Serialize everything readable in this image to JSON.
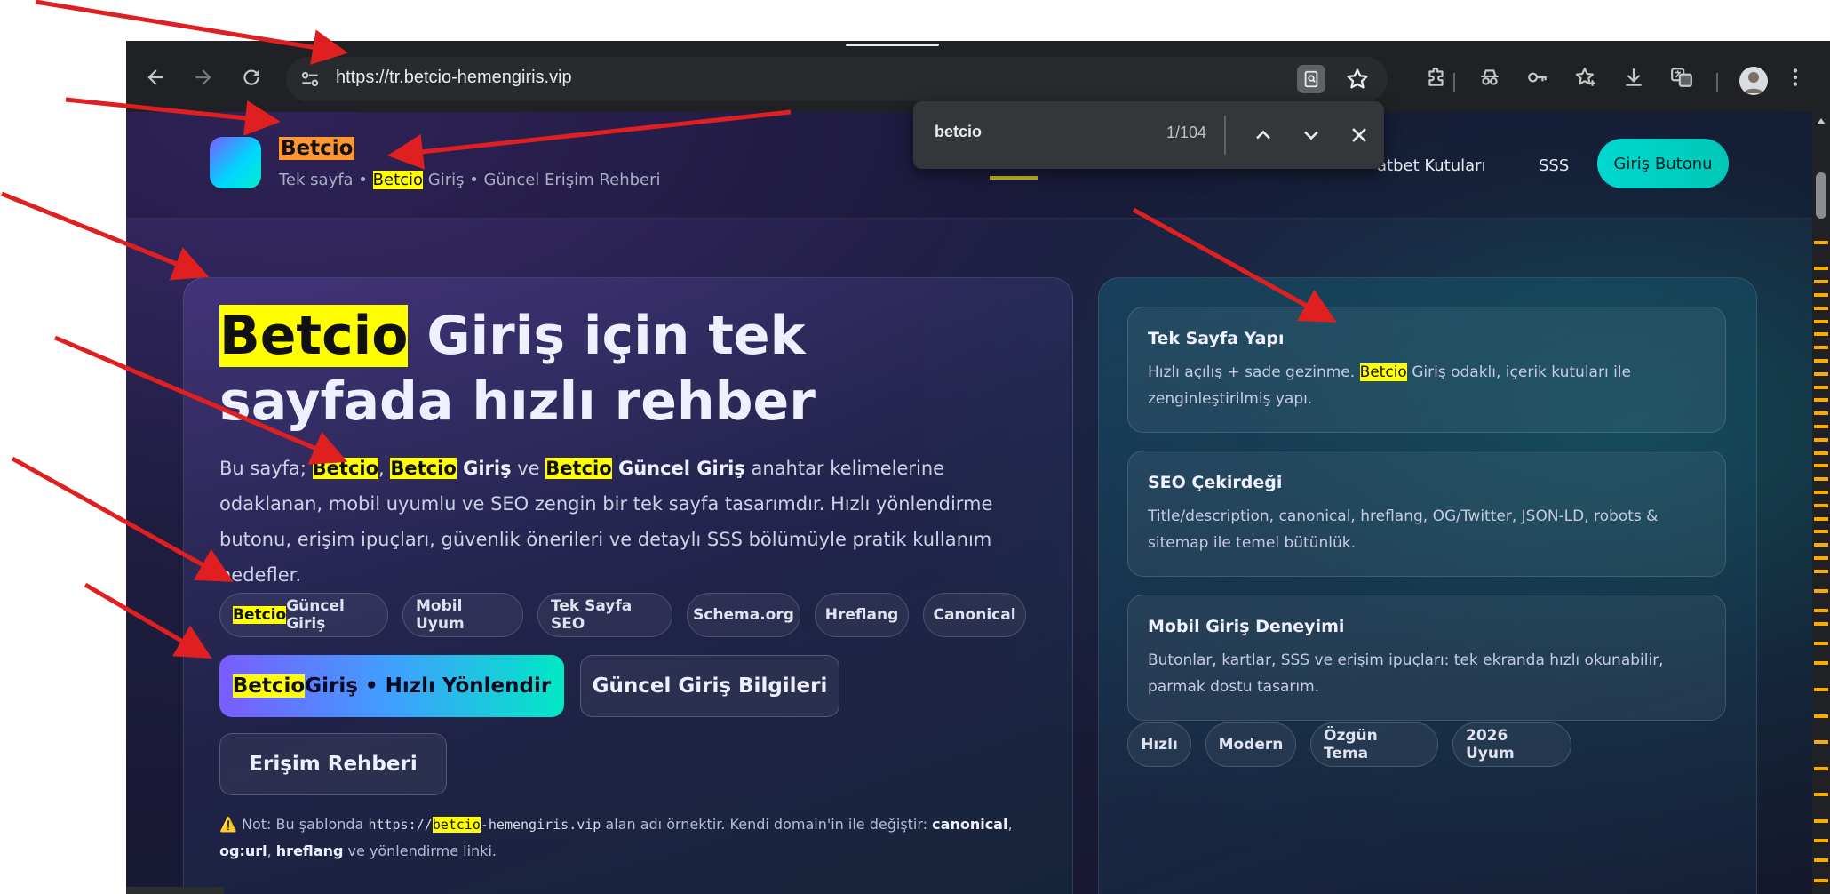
{
  "browser": {
    "url": "https://tr.betcio-hemengiris.vip",
    "find": {
      "query": "betcio",
      "count": "1/104"
    },
    "scroll_markers": [
      0.02,
      0.06,
      0.08,
      0.1,
      0.12,
      0.14,
      0.16,
      0.18,
      0.2,
      0.22,
      0.24,
      0.26,
      0.28,
      0.3,
      0.32,
      0.34,
      0.36,
      0.38,
      0.4,
      0.42,
      0.44,
      0.46,
      0.48,
      0.5,
      0.52,
      0.55,
      0.58,
      0.6,
      0.63,
      0.66,
      0.7,
      0.74,
      0.78,
      0.82,
      0.86,
      0.9,
      0.93,
      0.96,
      0.99
    ]
  },
  "header": {
    "brand": "Betcio",
    "tagline_pre": "Tek sayfa • ",
    "tagline_hl": "Betcio",
    "tagline_post": " Giriş • Güncel Erişim Rehberi",
    "nav_partial": "atbet Kutuları",
    "nav_faq": "SSS",
    "cta": "Giriş Butonu"
  },
  "hero": {
    "title_hl": "Betcio",
    "title_rest": " Giriş için tek sayfada hızlı rehber",
    "desc": {
      "p1": "Bu sayfa; ",
      "k1": "Betcio",
      "s1": ", ",
      "k2": "Betcio",
      "k2b": " Giriş",
      "s2": " ve ",
      "k3": "Betcio",
      "k3b": " Güncel Giriş",
      "p2": " anahtar kelimelerine odaklanan, mobil uyumlu ve SEO zengin bir tek sayfa tasarımdır. Hızlı yönlendirme butonu, erişim ipuçları, güvenlik önerileri ve detaylı SSS bölümüyle pratik kullanım hedefler."
    },
    "chips": {
      "c1_hl": "Betcio",
      "c1_rest": " Güncel Giriş",
      "c2": "Mobil Uyum",
      "c3": "Tek Sayfa SEO",
      "c4": "Schema.org",
      "c5": "Hreflang",
      "c6": "Canonical"
    },
    "buttons": {
      "redirect_hl": "Betcio",
      "redirect_rest": " Giriş • Hızlı Yönlendir",
      "current_info": "Güncel Giriş Bilgileri",
      "access_guide": "Erişim Rehberi"
    },
    "note": {
      "icon": "⚠️",
      "t1": " Not: Bu şablonda ",
      "code_pre": "https://",
      "code_hl": "betcio",
      "code_post": "-hemengiris.vip",
      "t2": " alan adı örnektir. Kendi domain'in ile değiştir: ",
      "b1": "canonical",
      "t3": ", ",
      "b2": "og:url",
      "t4": ", ",
      "b3": "hreflang",
      "t5": " ve yönlendirme linki."
    }
  },
  "features": {
    "f1": {
      "title": "Tek Sayfa Yapı",
      "desc_pre": "Hızlı açılış + sade gezinme. ",
      "desc_hl": "Betcio",
      "desc_post": " Giriş odaklı, içerik kutuları ile zenginleştirilmiş yapı."
    },
    "f2": {
      "title": "SEO Çekirdeği",
      "desc": "Title/description, canonical, hreflang, OG/Twitter, JSON-LD, robots & sitemap ile temel bütünlük."
    },
    "f3": {
      "title": "Mobil Giriş Deneyimi",
      "desc": "Butonlar, kartlar, SSS ve erişim ipuçları: tek ekranda hızlı okunabilir, parmak dostu tasarım."
    },
    "chips": {
      "c1": "Hızlı",
      "c2": "Modern",
      "c3": "Özgün Tema",
      "c4": "2026 Uyum"
    }
  },
  "colors": {
    "find_highlight": "#ffff00",
    "active_match": "#ff9632",
    "annotation_arrow": "#e02020",
    "cta_teal": "#00d8d0"
  }
}
